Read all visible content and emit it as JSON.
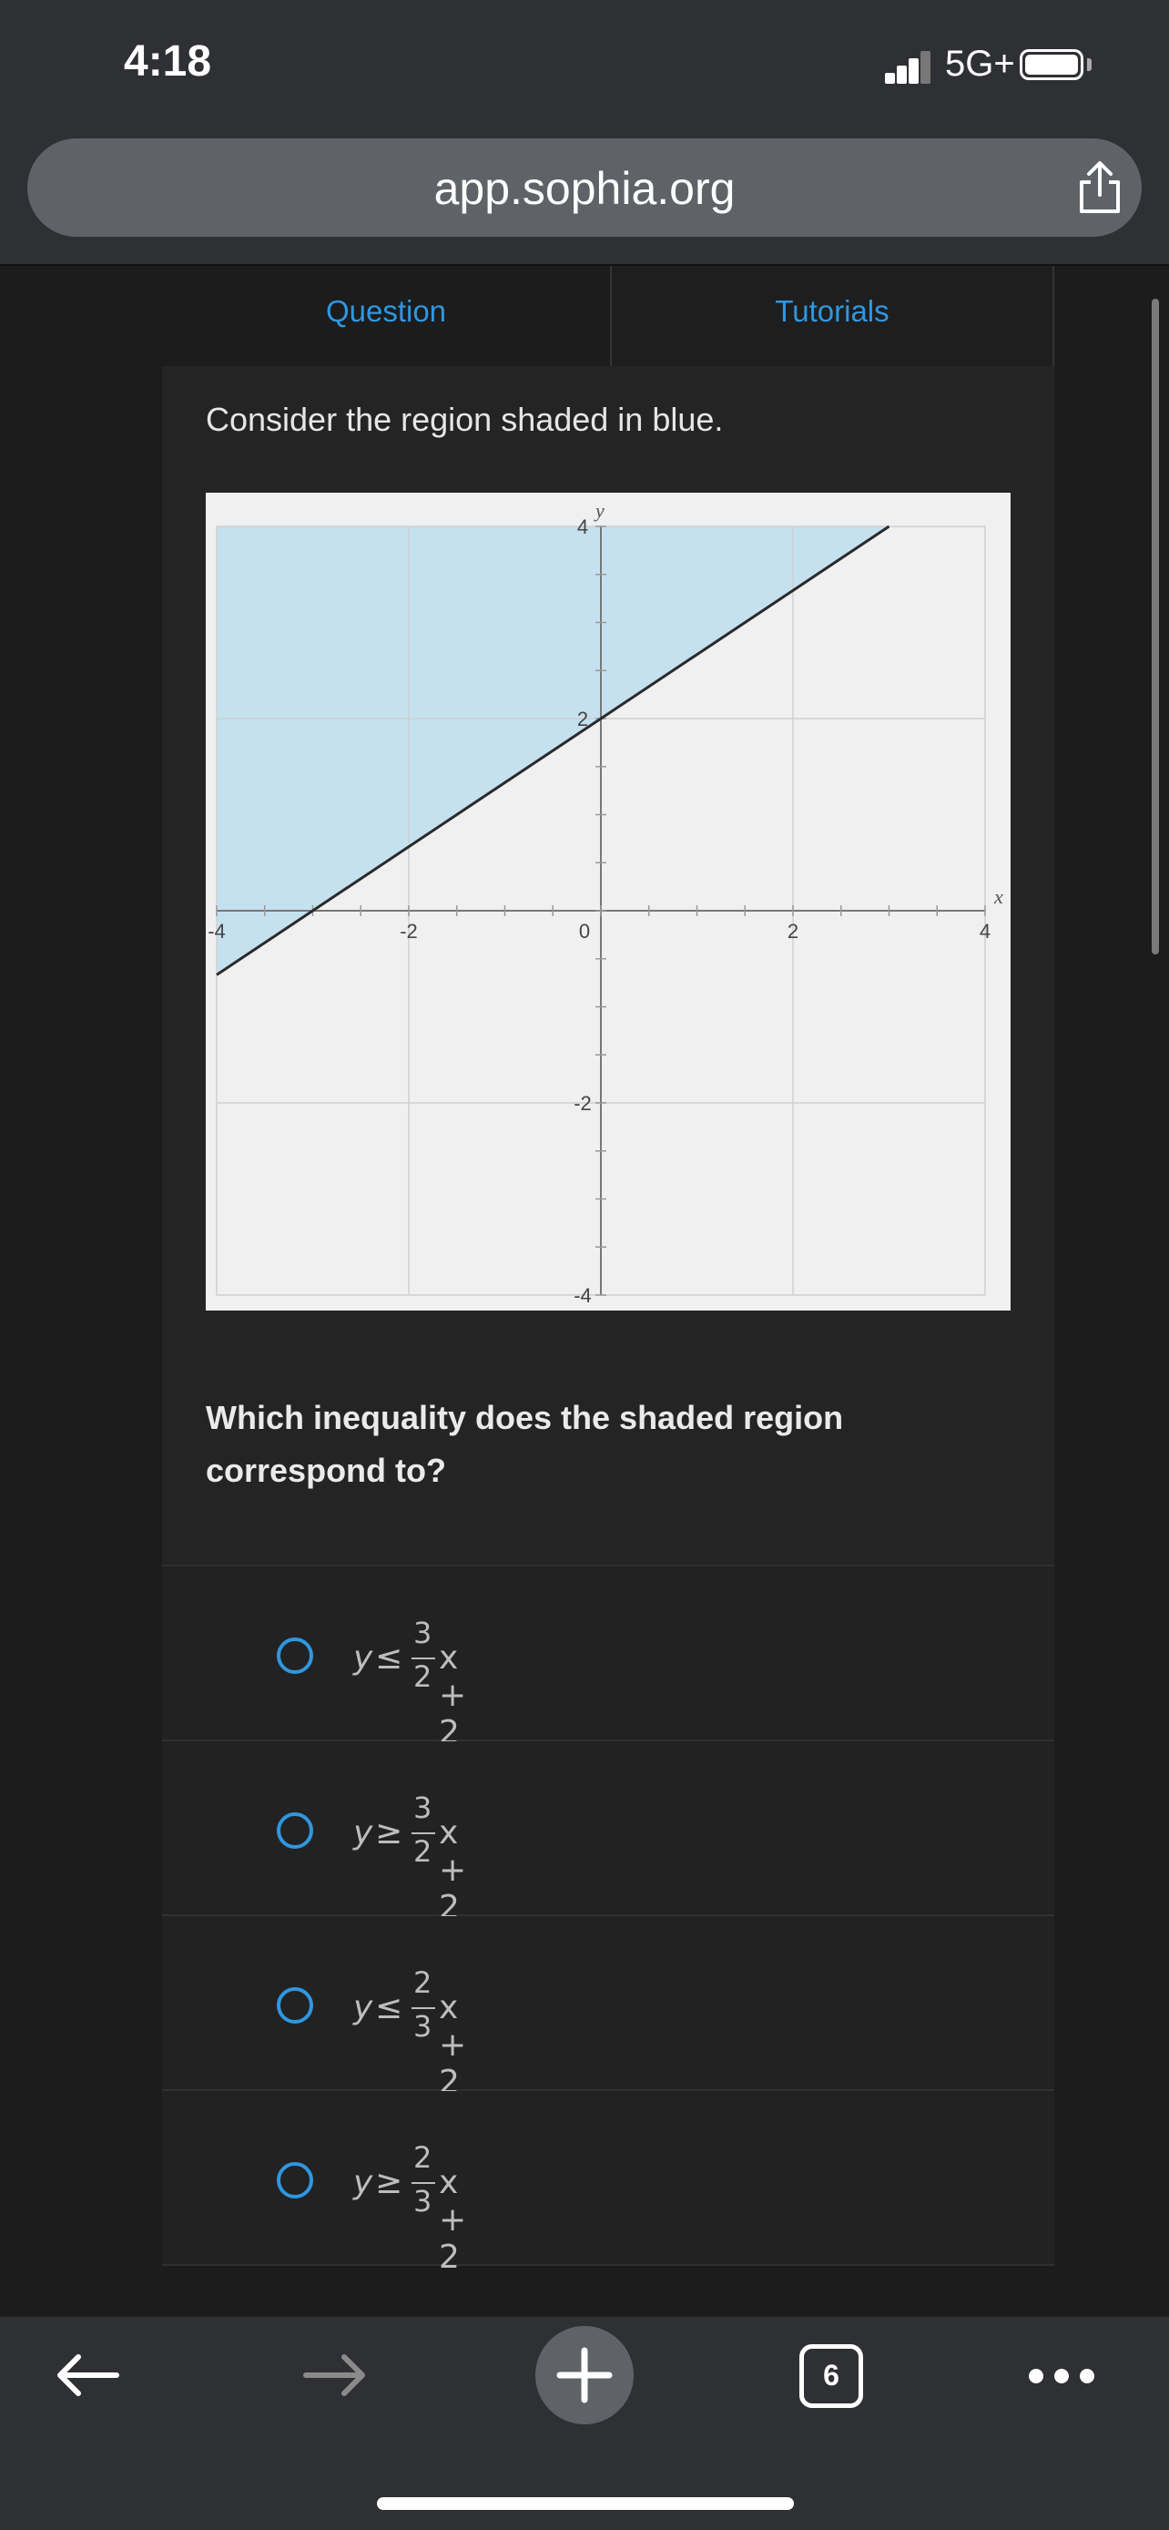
{
  "status_bar": {
    "time": "4:18",
    "network": "5G+",
    "icons": [
      "signal-icon",
      "battery-icon"
    ]
  },
  "browser": {
    "url": "app.sophia.org",
    "share_icon": "share-icon",
    "tab_count": "6",
    "toolbar_icons": [
      "back-arrow-icon",
      "forward-arrow-icon",
      "new-tab-plus-icon",
      "tabs-icon",
      "more-icon"
    ]
  },
  "tabs": [
    {
      "label": "Question"
    },
    {
      "label": "Tutorials"
    }
  ],
  "question": {
    "prompt": "Consider the region shaded in blue.",
    "text": "Which inequality does the shaded region correspond to?"
  },
  "chart_data": {
    "type": "line",
    "xlabel": "x",
    "ylabel": "y",
    "xlim": [
      -4,
      4
    ],
    "ylim": [
      -4,
      4
    ],
    "x_ticks": [
      "-4",
      "-2",
      "0",
      "2",
      "4"
    ],
    "y_ticks": [
      "4",
      "2",
      "-2",
      "-4"
    ],
    "grid": true,
    "line": {
      "slope": 0.6667,
      "intercept": 2,
      "x": [
        -4,
        3
      ],
      "y": [
        -0.667,
        4
      ]
    },
    "shaded_region": "above line",
    "colors": {
      "shade": "#c5e1f0",
      "line": "#2a2a2a",
      "background": "#f0f0f0"
    }
  },
  "options": [
    {
      "lhs": "y",
      "op": "≤",
      "num": "3",
      "den": "2",
      "rhs": "x + 2"
    },
    {
      "lhs": "y",
      "op": "≥",
      "num": "3",
      "den": "2",
      "rhs": "x + 2"
    },
    {
      "lhs": "y",
      "op": "≤",
      "num": "2",
      "den": "3",
      "rhs": "x + 2"
    },
    {
      "lhs": "y",
      "op": "≥",
      "num": "2",
      "den": "3",
      "rhs": "x + 2"
    }
  ],
  "colors": {
    "accent": "#2f97e0",
    "chrome": "#2f3033",
    "page": "#1c1c1c",
    "card": "#242424"
  }
}
